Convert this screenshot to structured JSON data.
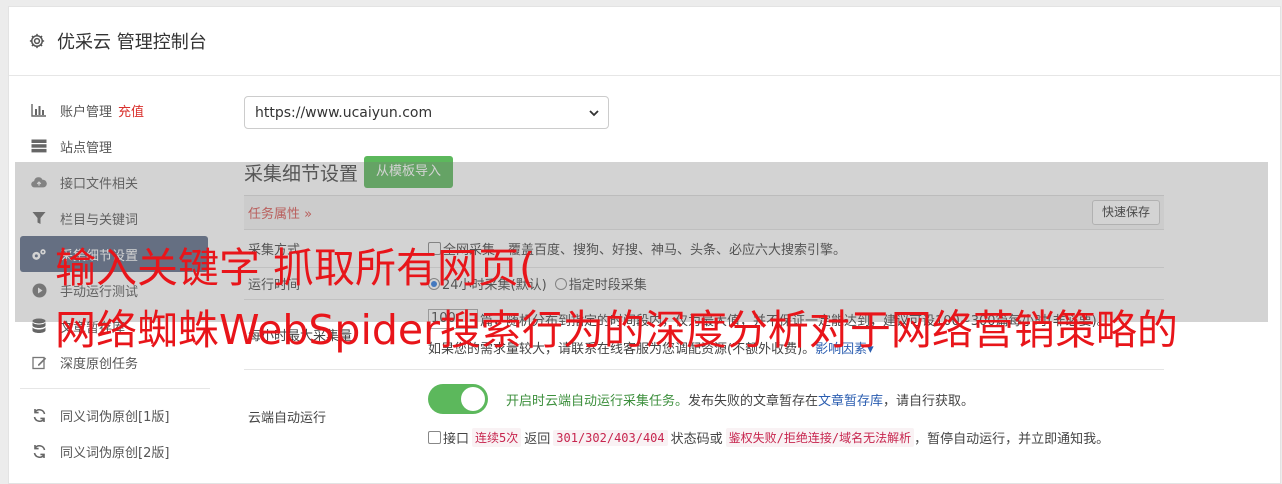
{
  "header": {
    "title": "优采云 管理控制台"
  },
  "sidebar": {
    "items": [
      {
        "label": "账户管理",
        "badge": "充值",
        "icon": "bar-chart-icon"
      },
      {
        "label": "站点管理",
        "icon": "server-icon"
      },
      {
        "label": "接口文件相关",
        "icon": "cloud-upload-icon"
      },
      {
        "label": "栏目与关键词",
        "icon": "filter-icon"
      },
      {
        "label": "采集细节设置",
        "icon": "cogs-icon"
      },
      {
        "label": "手动运行测试",
        "icon": "play-circle-icon"
      },
      {
        "label": "文章暂存库",
        "icon": "database-icon"
      },
      {
        "label": "深度原创任务",
        "icon": "edit-icon"
      },
      {
        "label": "同义词伪原创[1版]",
        "icon": "refresh-icon"
      },
      {
        "label": "同义词伪原创[2版]",
        "icon": "refresh-icon"
      }
    ]
  },
  "main": {
    "site_select": "https://www.ucaiyun.com",
    "section_title": "采集细节设置",
    "import_button": "从模板导入",
    "task_header": "任务属性",
    "save_button": "快速保存",
    "rows": {
      "engines_label": "采集方式",
      "engines_text": "全网采集，覆盖百度、搜狗、好搜、神马、头条、必应六大搜索引擎。",
      "runtime_label": "运行时间",
      "runtime_opt1": "24小时采集(默认)",
      "runtime_opt2": "指定时段采集",
      "max_label": "每小时最大采集量",
      "max_value": "100",
      "max_text": "篇，随机分布到指定的时间段内，仅为最大值，并不保证一定能达到，建议可设100~300篇每小时(非必要)。",
      "max_note": "如果您的需求量较大，请联系在线客服为您调配资源(不额外收费)。",
      "max_link": "影响因素",
      "cloud_label": "云端自动运行",
      "cloud_text_green": "开启时云端自动运行采集任务。",
      "cloud_text": "发布失败的文章暂存在",
      "cloud_link": "文章暂存库",
      "cloud_text_end": "，请自行获取。",
      "api_check": "接口",
      "api_code1": "连续5次",
      "api_text1": "返回",
      "api_code2": "301/302/403/404",
      "api_text2": "状态码或",
      "api_code3": "鉴权失败/拒绝连接/域名无法解析",
      "api_text3": "，暂停自动运行，并立即通知我。"
    }
  },
  "overlay": {
    "line1": "输入关键字 抓取所有网页(",
    "line2": "网络蜘蛛WebSpider搜索行为的深度分析对于网络营销策略的"
  }
}
